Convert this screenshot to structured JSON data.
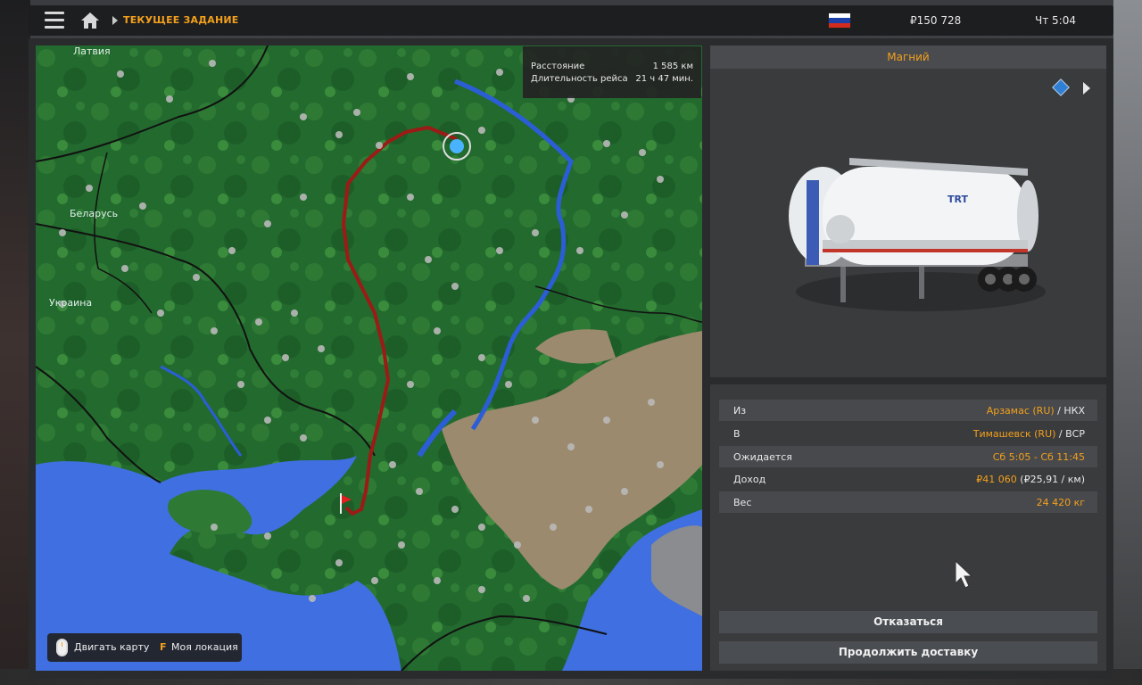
{
  "topbar": {
    "breadcrumb": "ТЕКУЩЕЕ ЗАДАНИЕ",
    "money": "₽150 728",
    "clock": "Чт 5:04",
    "flag_colors": [
      "#ffffff",
      "#1c3fa8",
      "#d52b1e"
    ]
  },
  "map": {
    "info": {
      "distance_label": "Расстояние",
      "distance_value": "1 585 км",
      "duration_label": "Длительность рейса",
      "duration_value": "21 ч 47 мин."
    },
    "countries": {
      "latvia": "Латвия",
      "belarus": "Беларусь",
      "ukraine": "Украина"
    },
    "controls": {
      "move_icon": "mouse-icon",
      "move_label": "Двигать карту",
      "location_key": "F",
      "location_label": "Моя локация"
    },
    "route_color": "#9b1b16"
  },
  "trailer": {
    "cargo": "Магний",
    "adr_icon": "adr-diamond-icon",
    "next_icon": "arrow-right-icon"
  },
  "details": {
    "from_label": "Из",
    "from_city": "Арзамас (RU)",
    "from_company": "НКХ",
    "to_label": "В",
    "to_city": "Тимашевск (RU)",
    "to_company": "ВСР",
    "expected_label": "Ожидается",
    "expected_value": "Сб 5:05 - Сб 11:45",
    "income_label": "Доход",
    "income_value": "₽41 060",
    "income_rate": "(₽25,91 / км)",
    "weight_label": "Вес",
    "weight_value": "24 420 кг"
  },
  "buttons": {
    "decline": "Отказаться",
    "continue": "Продолжить доставку"
  },
  "colors": {
    "accent": "#f2a01c",
    "map_forest": "#236a2e",
    "map_land": "#3f8a3a",
    "map_steppe": "#9b8a6e",
    "map_water": "#3f6fe0"
  }
}
